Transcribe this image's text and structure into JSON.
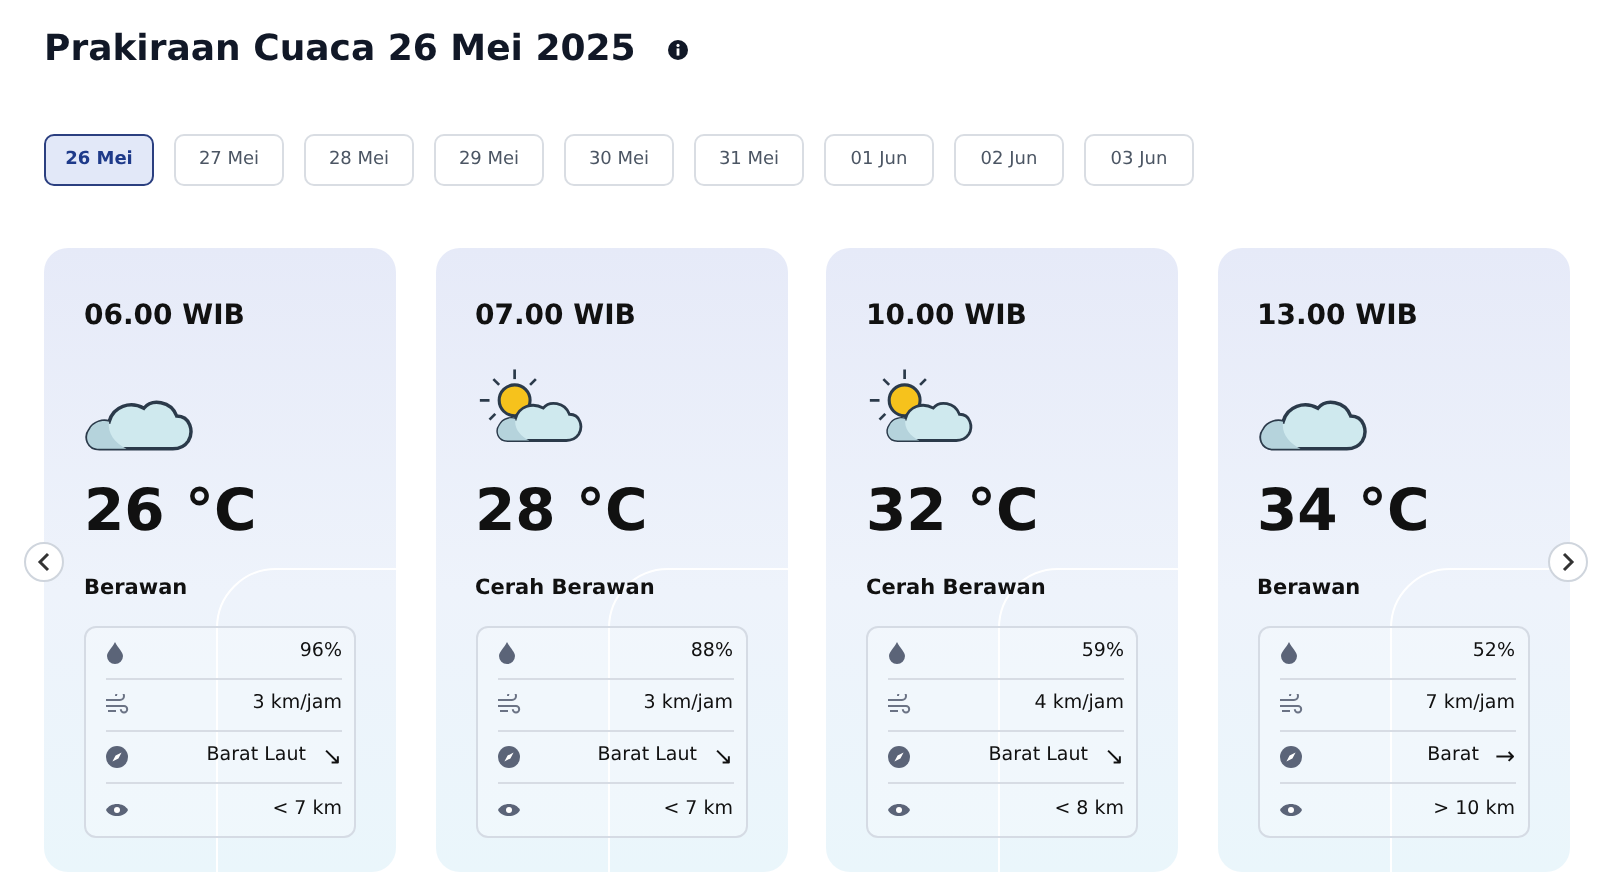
{
  "title": "Prakiraan Cuaca 26 Mei 2025",
  "dates": [
    {
      "label": "26 Mei",
      "selected": true
    },
    {
      "label": "27 Mei",
      "selected": false
    },
    {
      "label": "28 Mei",
      "selected": false
    },
    {
      "label": "29 Mei",
      "selected": false
    },
    {
      "label": "30 Mei",
      "selected": false
    },
    {
      "label": "31 Mei",
      "selected": false
    },
    {
      "label": "01 Jun",
      "selected": false
    },
    {
      "label": "02 Jun",
      "selected": false
    },
    {
      "label": "03 Jun",
      "selected": false
    }
  ],
  "forecasts": [
    {
      "time": "06.00 WIB",
      "kind": "cloudy",
      "temperature": "26 °C",
      "condition": "Berawan",
      "humidity": "96%",
      "wind_speed": "3 km/jam",
      "wind_direction": "Barat Laut",
      "wind_arrow": "↘",
      "visibility": "< 7 km"
    },
    {
      "time": "07.00 WIB",
      "kind": "partly_cloudy",
      "temperature": "28 °C",
      "condition": "Cerah Berawan",
      "humidity": "88%",
      "wind_speed": "3 km/jam",
      "wind_direction": "Barat Laut",
      "wind_arrow": "↘",
      "visibility": "< 7 km"
    },
    {
      "time": "10.00 WIB",
      "kind": "partly_cloudy",
      "temperature": "32 °C",
      "condition": "Cerah Berawan",
      "humidity": "59%",
      "wind_speed": "4 km/jam",
      "wind_direction": "Barat Laut",
      "wind_arrow": "↘",
      "visibility": "< 8 km"
    },
    {
      "time": "13.00 WIB",
      "kind": "cloudy",
      "temperature": "34 °C",
      "condition": "Berawan",
      "humidity": "52%",
      "wind_speed": "7 km/jam",
      "wind_direction": "Barat",
      "wind_arrow": "→",
      "visibility": "> 10 km"
    }
  ]
}
